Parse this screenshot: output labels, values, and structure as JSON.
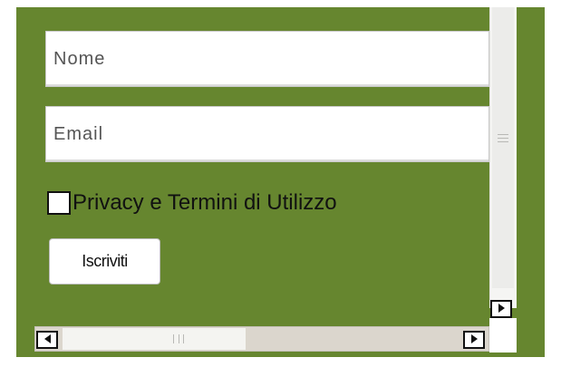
{
  "form": {
    "name_placeholder": "Nome",
    "name_value": "",
    "email_placeholder": "Email",
    "email_value": "",
    "privacy_label": "Privacy e Termini di Utilizzo",
    "privacy_checked": false,
    "submit_label": "Iscriviti"
  },
  "colors": {
    "background": "#66862f",
    "field_bg": "#ffffff",
    "button_bg": "#ffffff"
  },
  "scrollbars": {
    "vertical": {
      "grip_icon": "grip-lines-icon",
      "down_button_icon": "arrow-right-icon"
    },
    "horizontal": {
      "left_button_icon": "arrow-left-icon",
      "right_button_icon": "arrow-right-icon",
      "grip_icon": "grip-lines-icon"
    }
  }
}
